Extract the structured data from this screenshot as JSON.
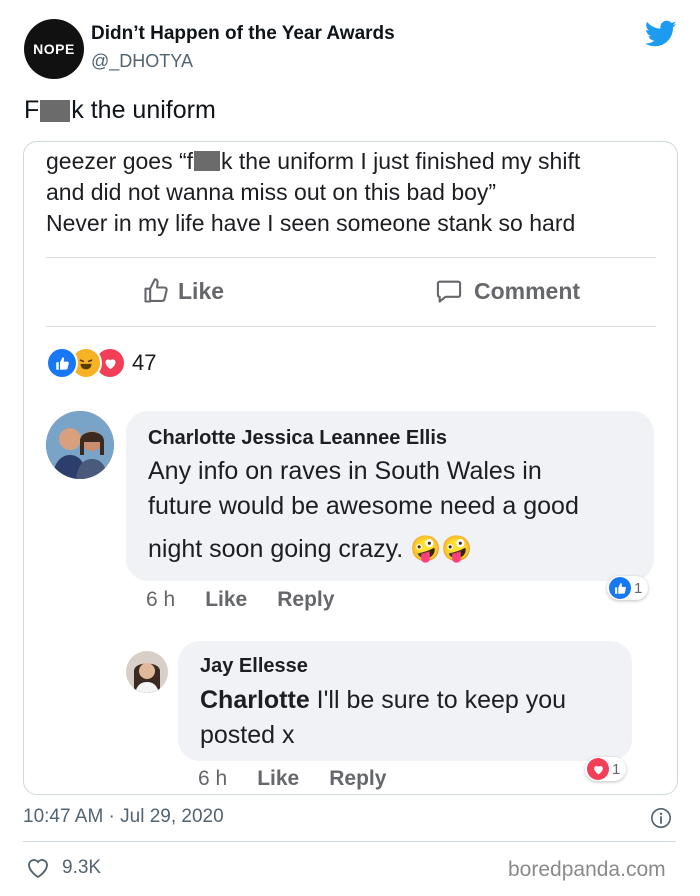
{
  "tweet": {
    "account_name": "Didn’t Happen of the Year Awards",
    "handle": "@_DHOTYA",
    "avatar_text": "NOPE",
    "text_start": "F",
    "text_end": "k the uniform",
    "timestamp": "10:47 AM · Jul 29, 2020",
    "likes": "9.3K",
    "brand_color": "#1d9bf0"
  },
  "screenshot": {
    "post_lines": [
      "geezer goes “f",
      "k the uniform I just finished my shift",
      "and did not wanna miss out on this bad boy”",
      "Never in my life have I seen someone stank so hard"
    ],
    "like_label": "Like",
    "comment_label": "Comment",
    "reaction_count": "47",
    "comments": [
      {
        "name": "Charlotte Jessica Leannee Ellis",
        "lines": [
          "Any info on raves in South Wales in",
          "future would be awesome need a good",
          "night soon going crazy. 🤪🤪"
        ],
        "time": "6 h",
        "like": "Like",
        "reply": "Reply",
        "reactions": "1"
      },
      {
        "name": "Jay Ellesse",
        "mention": "Charlotte",
        "line1_rest": " I'll be sure to keep you",
        "line2": "posted x",
        "time": "6 h",
        "like": "Like",
        "reply": "Reply",
        "reactions": "1"
      }
    ]
  },
  "watermark": "boredpanda.com"
}
